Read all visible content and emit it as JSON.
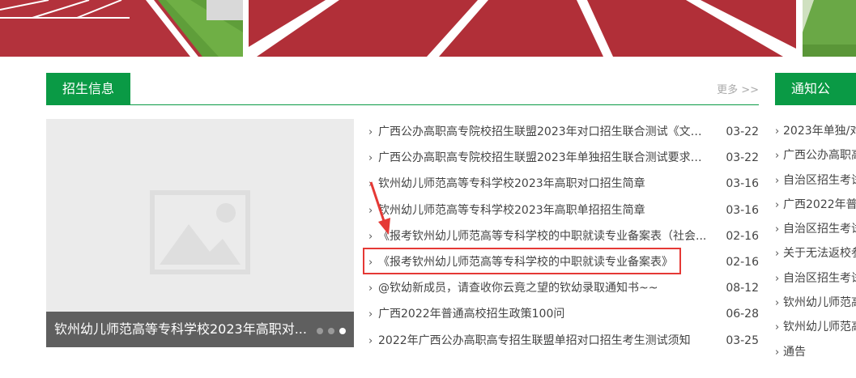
{
  "admissions": {
    "title": "招生信息",
    "more": "更多 >>",
    "featured_caption": "钦州幼儿师范高等专科学校2023年高职对...",
    "items": [
      {
        "title": "广西公办高职高专院校招生联盟2023年对口招生联合测试《文化...",
        "date": "03-22"
      },
      {
        "title": "广西公办高职高专院校招生联盟2023年单独招生联合测试要求和...",
        "date": "03-22"
      },
      {
        "title": "钦州幼儿师范高等专科学校2023年高职对口招生简章",
        "date": "03-16"
      },
      {
        "title": "钦州幼儿师范高等专科学校2023年高职单招招生简章",
        "date": "03-16"
      },
      {
        "title": "《报考钦州幼儿师范高等专科学校的中职就读专业备案表（社会...",
        "date": "02-16"
      },
      {
        "title": "《报考钦州幼儿师范高等专科学校的中职就读专业备案表》",
        "date": "02-16"
      },
      {
        "title": "@钦幼新成员，请查收你云竟之望的钦幼录取通知书~~",
        "date": "08-12"
      },
      {
        "title": "广西2022年普通高校招生政策100问",
        "date": "06-28"
      },
      {
        "title": "2022年广西公办高职高专招生联盟单招对口招生考生测试须知",
        "date": "03-25"
      }
    ]
  },
  "notices": {
    "title": "通知公告",
    "items": [
      "2023年单独/对",
      "广西公办高职高",
      "自治区招生考试",
      "广西2022年普通",
      "自治区招生考试",
      "关于无法返校参",
      "自治区招生考试",
      "钦州幼儿师范高",
      "钦州幼儿师范高",
      "通告"
    ]
  },
  "icons": {
    "chevron": "chevron-right-icon",
    "placeholder": "image-placeholder-icon",
    "annotation_arrow": "red-arrow-icon"
  },
  "colors": {
    "accent_green": "#0a9a45",
    "highlight_red": "#e53935",
    "track_red": "#b5303a"
  }
}
